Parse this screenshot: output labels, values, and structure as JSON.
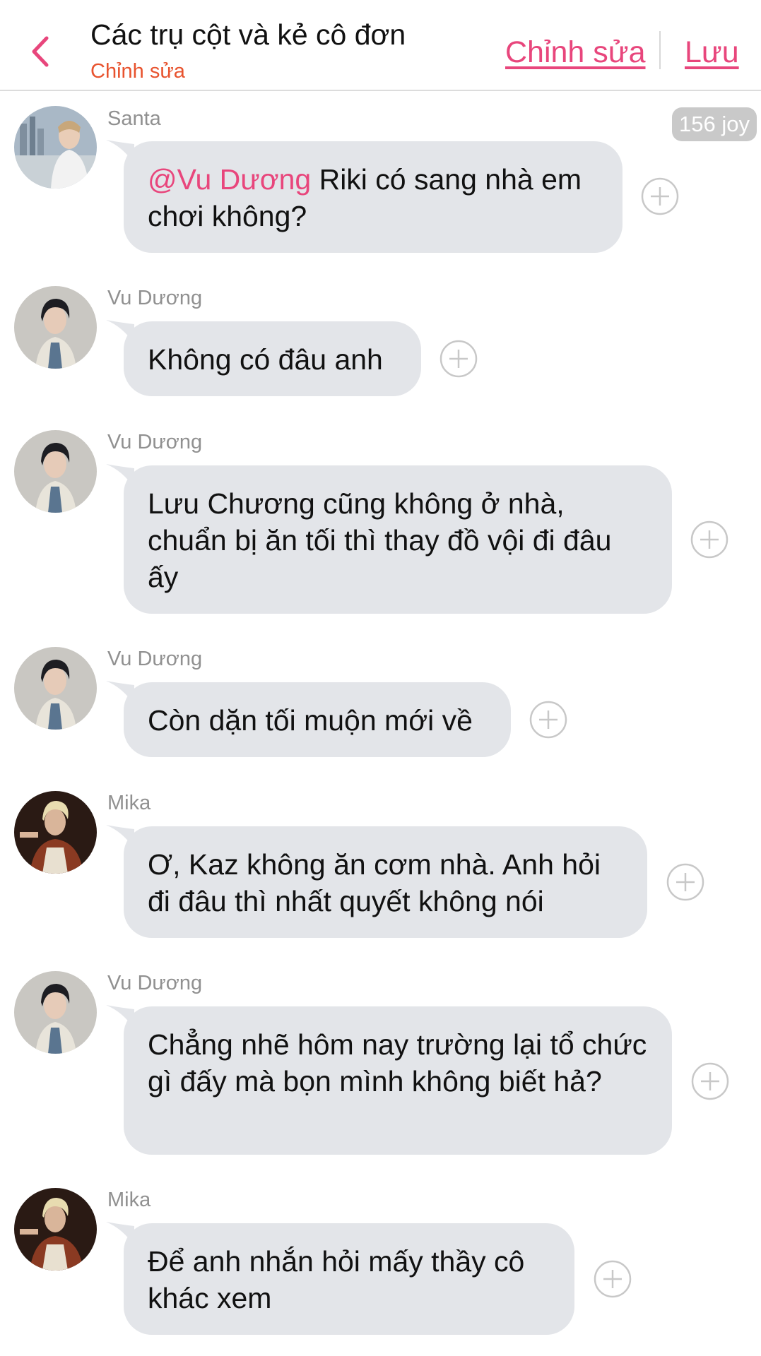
{
  "header": {
    "title": "Các trụ cột và kẻ cô đơn",
    "subtitle": "Chỉnh sửa",
    "edit_label": "Chỉnh sửa",
    "save_label": "Lưu",
    "back_icon": "chevron-left-icon"
  },
  "coins": "156 joy",
  "colors": {
    "accent": "#e8467c",
    "subtitle": "#e8532e",
    "bubble": "#e3e5e9"
  },
  "messages": [
    {
      "sender": "Santa",
      "mention": "@Vu Dương",
      "text": " Riki có sang nhà em chơi không?"
    },
    {
      "sender": "Vu Dương",
      "text": "Không có đâu anh"
    },
    {
      "sender": "Vu Dương",
      "text": "Lưu Chương cũng không ở nhà, chuẩn bị ăn tối thì thay đồ vội đi đâu ấy"
    },
    {
      "sender": "Vu Dương",
      "text": "Còn dặn tối muộn mới về"
    },
    {
      "sender": "Mika",
      "text": "Ơ, Kaz không ăn cơm nhà. Anh hỏi đi đâu thì nhất quyết không nói"
    },
    {
      "sender": "Vu Dương",
      "text": "Chẳng nhẽ hôm nay trường lại tổ chức gì đấy mà bọn mình không biết hả?"
    },
    {
      "sender": "Mika",
      "text": "Để anh nhắn hỏi mấy thầy cô khác xem"
    }
  ]
}
